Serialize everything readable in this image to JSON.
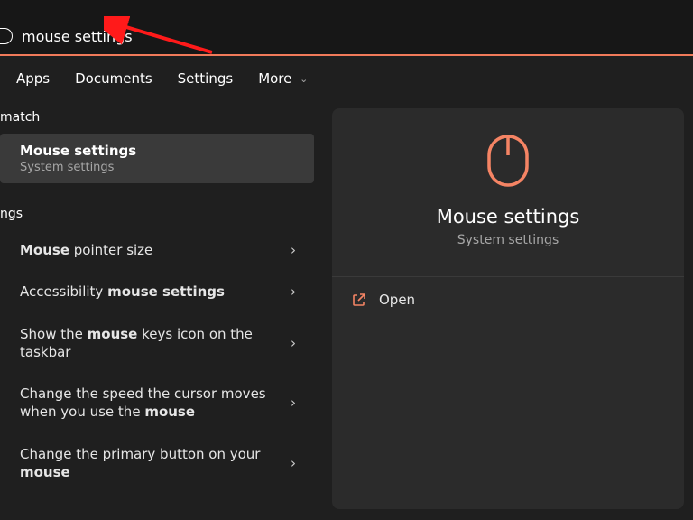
{
  "search": {
    "value": "mouse settings"
  },
  "tabs": {
    "apps": "Apps",
    "documents": "Documents",
    "settings": "Settings",
    "more": "More"
  },
  "sections": {
    "best_match": "match",
    "settings": "ngs"
  },
  "best_match": {
    "title": "Mouse settings",
    "subtitle": "System settings"
  },
  "results": [
    {
      "prefix": "",
      "bold": "Mouse",
      "suffix": " pointer size"
    },
    {
      "prefix": "Accessibility ",
      "bold": "mouse settings",
      "suffix": ""
    },
    {
      "prefix": "Show the ",
      "bold": "mouse",
      "suffix": " keys icon on the taskbar"
    },
    {
      "prefix": "Change the speed the cursor moves when you use the ",
      "bold": "mouse",
      "suffix": ""
    },
    {
      "prefix": "Change the primary button on your ",
      "bold": "mouse",
      "suffix": ""
    }
  ],
  "preview": {
    "title": "Mouse settings",
    "subtitle": "System settings",
    "open_label": "Open"
  },
  "colors": {
    "accent": "#f58464"
  }
}
